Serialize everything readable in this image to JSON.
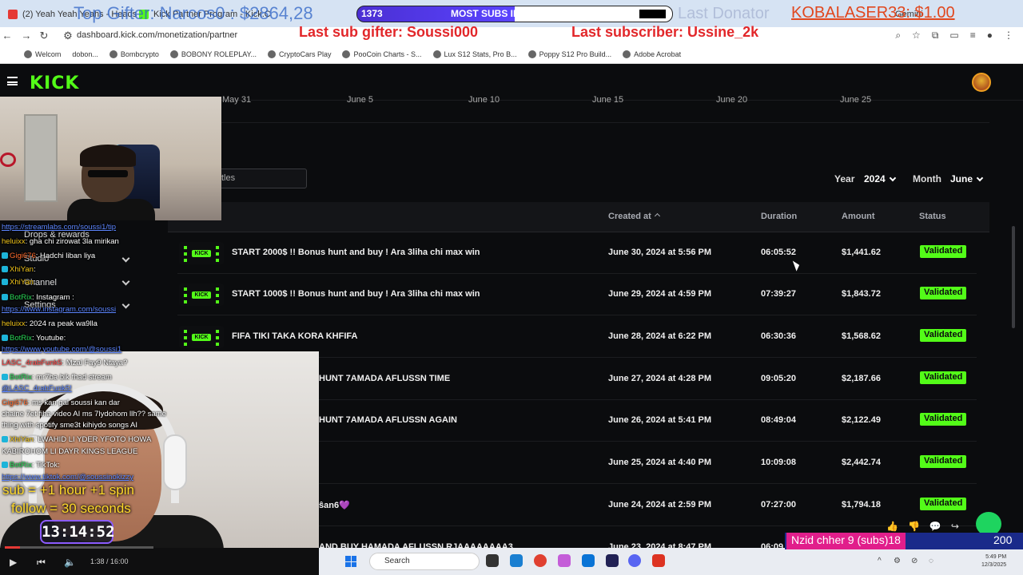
{
  "browser": {
    "tabs": [
      {
        "label": "(2) Yeah Yeah Yeahs - Heads",
        "color": "#e53935"
      },
      {
        "label": "Kick Partner Program - Kick.C",
        "color": "#53fc18"
      }
    ],
    "url": "dashboard.kick.com/monetization/partner",
    "bookmarks": [
      "Welcom",
      "dobon...",
      "Bombcrypto",
      "BOBONY ROLEPLAY...",
      "CryptoCars Play",
      "PooCoin Charts - S...",
      "Lux S12 Stats, Pro B...",
      "Poppy S12 Pro Build...",
      "Adobe Acrobat"
    ],
    "gemini": "Gemini"
  },
  "overlay": {
    "top_gifter": "Top Gifter: Narcos0 : $2864,28",
    "subs_count": "1373",
    "subs_title": "MOST SUBS IN MOROCCO",
    "last_donator": "Last Donator",
    "kobalaser": "KOBALASER33: $1.00",
    "last_sub_gifter": "Last sub gifter: Soussi000",
    "last_subscriber": "Last subscriber: Ussine_2k",
    "sub_rule": "sub = +1 hour +1 spin",
    "follow_rule": "follow = 30 seconds",
    "timer": "13:14:52",
    "ticker_label": "Nzid chher 9 (subs)18",
    "ticker_num": "200"
  },
  "kick": {
    "logo": "KICK",
    "chart_dates": [
      "May 31",
      "June 5",
      "June 10",
      "June 15",
      "June 20",
      "June 25"
    ],
    "section_title": "s",
    "search_placeholder": "tles",
    "year_label": "Year",
    "year_value": "2024",
    "month_label": "Month",
    "month_value": "June",
    "columns": {
      "created": "Created at",
      "duration": "Duration",
      "amount": "Amount",
      "status": "Status"
    },
    "rows": [
      {
        "title": "START 2000$ !! Bonus hunt and buy ! Ara 3liha chi max win",
        "created": "June 30, 2024 at 5:56 PM",
        "duration": "06:05:52",
        "amount": "$1,441.62",
        "status": "Validated"
      },
      {
        "title": "START 1000$ !! Bonus hunt and buy ! Ara 3liha chi max win",
        "created": "June 29, 2024 at 4:59 PM",
        "duration": "07:39:27",
        "amount": "$1,843.72",
        "status": "Validated"
      },
      {
        "title": "FIFA TIKI TAKA KORA KHFIFA",
        "created": "June 28, 2024 at 6:22 PM",
        "duration": "06:30:36",
        "amount": "$1,568.62",
        "status": "Validated"
      },
      {
        "title": "HUNT 7AMADA AFLUSSN TIME",
        "created": "June 27, 2024 at 4:28 PM",
        "duration": "09:05:20",
        "amount": "$2,187.66",
        "status": "Validated"
      },
      {
        "title": "HUNT 7AMADA AFLUSSN AGAIN",
        "created": "June 26, 2024 at 5:41 PM",
        "duration": "08:49:04",
        "amount": "$2,122.49",
        "status": "Validated"
      },
      {
        "title": "",
        "created": "June 25, 2024 at 4:40 PM",
        "duration": "10:09:08",
        "amount": "$2,442.74",
        "status": "Validated"
      },
      {
        "title": "ŝan6💜",
        "created": "June 24, 2024 at 2:59 PM",
        "duration": "07:27:00",
        "amount": "$1,794.18",
        "status": "Validated"
      },
      {
        "title": "AND BUY HAMADA AFLUSSN RJAAAAAAAA3",
        "created": "June 23, 2024 at 8:47 PM",
        "duration": "06:09",
        "amount": "",
        "status": ""
      }
    ]
  },
  "sidebar": {
    "drops": "Drops & rewards",
    "studio": "Studio",
    "channel": "Channel",
    "settings": "Settings"
  },
  "chat": [
    {
      "user": "",
      "msg": "https://streamlabs.com/soussi1/tip",
      "link": true
    },
    {
      "user": "heluixx",
      "msg": ": gha chi zirowat 3la mirikan",
      "cls": "u1"
    },
    {
      "user": "Gigi676",
      "msg": ": Hadchi liban liya",
      "cls": "u5"
    },
    {
      "user": "XhiYan",
      "msg": ":",
      "cls": "u1"
    },
    {
      "user": "XhiYan",
      "msg": ":",
      "cls": "u1"
    },
    {
      "user": "BotRix",
      "msg": ": Instagram :",
      "cls": "u4"
    },
    {
      "user": "",
      "msg": "https://www.instagram.com/soussi",
      "link": true
    },
    {
      "user": "heluixx",
      "msg": ": 2024 ra peak wa9lla",
      "cls": "u1"
    },
    {
      "user": "BotRix",
      "msg": ": Youtube:",
      "cls": "u4"
    },
    {
      "user": "",
      "msg": "https://www.youtube.com/@soussi1",
      "link": true
    },
    {
      "user": "LASC_4rabFunk5",
      "msg": ": Mzal Fay9 Ntaya?",
      "cls": "u2"
    },
    {
      "user": "BotRix",
      "msg": ": mr7ba bik fhad stream",
      "cls": "u4"
    },
    {
      "user": "",
      "msg": "@LASC_4rabFunk5!",
      "link": true
    },
    {
      "user": "Gigi676",
      "msg": ": ms kan gal soussi kan dar",
      "cls": "u5"
    },
    {
      "user": "",
      "msg": "chaine 7et fiha video AI ms 7lydohom llh?? same"
    },
    {
      "user": "",
      "msg": "thing with spotify sme3t kihiydo songs AI"
    },
    {
      "user": "XhiYan",
      "msg": ": LWAHID LI YDER YFOTO HOWA",
      "cls": "u1"
    },
    {
      "user": "",
      "msg": "KABIROHOM LI DAYR KINGS LEAGUE"
    },
    {
      "user": "BotRix",
      "msg": ": TikTok:",
      "cls": "u4"
    },
    {
      "user": "",
      "msg": "https://www.tiktok.com/@soussinokizzy",
      "link": true
    }
  ],
  "player": {
    "time": "1:38 / 16:00",
    "progress": 0.1
  },
  "taskbar": {
    "search": "Search",
    "time": "5:49 PM",
    "date": "12/3/2025"
  }
}
